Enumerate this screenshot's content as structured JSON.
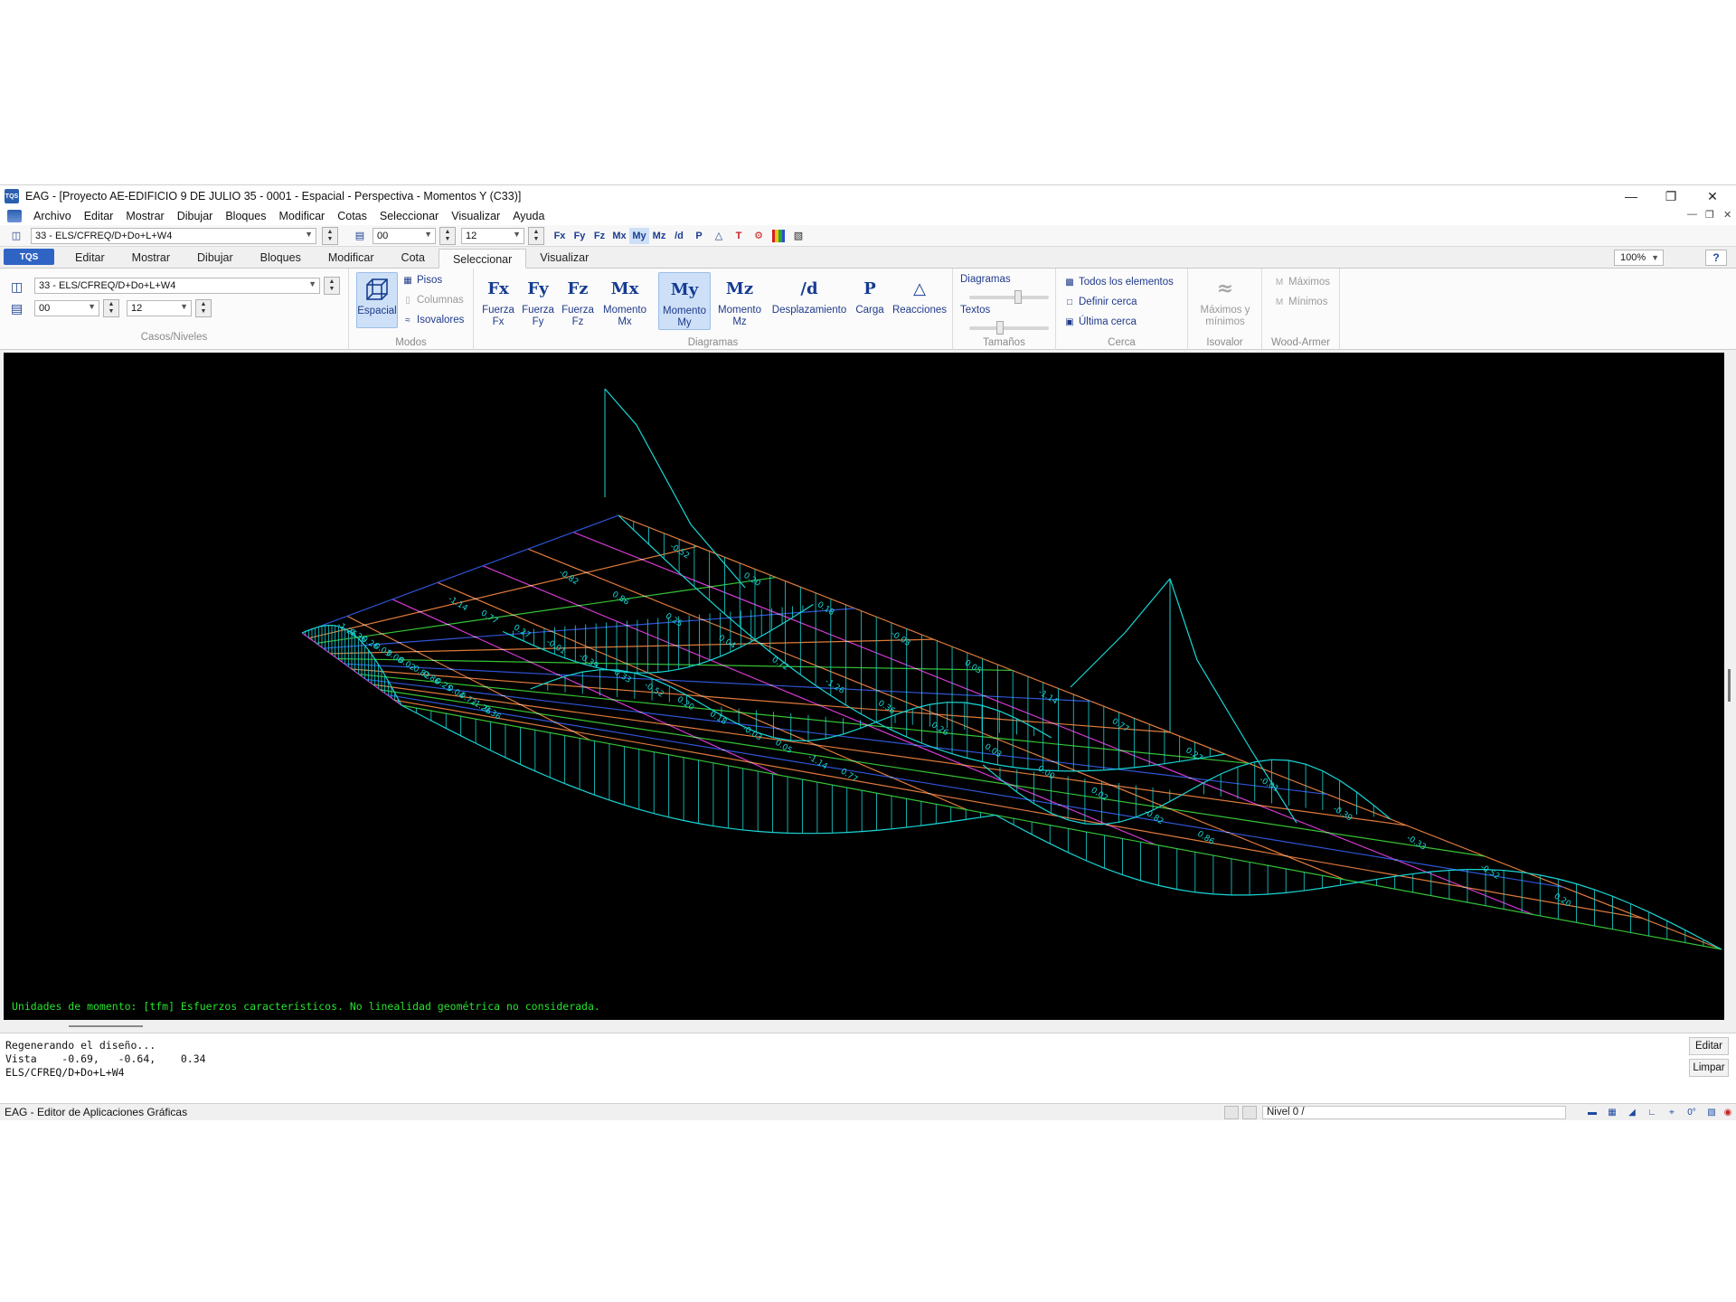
{
  "window": {
    "title": "EAG - [Proyecto AE-EDIFICIO 9 DE JULIO 35 - 0001 - Espacial - Perspectiva - Momentos Y (C33)]",
    "logo": "TQS"
  },
  "menu": [
    "Archivo",
    "Editar",
    "Mostrar",
    "Dibujar",
    "Bloques",
    "Modificar",
    "Cotas",
    "Seleccionar",
    "Visualizar",
    "Ayuda"
  ],
  "quickbar": {
    "case_value": "33 - ELS/CFREQ/D+Do+L+W4",
    "level_from": "00",
    "level_to": "12",
    "icons": [
      "Fx",
      "Fy",
      "Fz",
      "Mx",
      "My",
      "Mz",
      "/d",
      "P"
    ]
  },
  "tabs": {
    "app_button": "TQS",
    "items": [
      "Editar",
      "Mostrar",
      "Dibujar",
      "Bloques",
      "Modificar",
      "Cota",
      "Seleccionar",
      "Visualizar"
    ],
    "active": "Seleccionar",
    "zoom": "100%",
    "help": "?"
  },
  "ribbon": {
    "casos": {
      "case_value": "33 - ELS/CFREQ/D+Do+L+W4",
      "level_from": "00",
      "level_to": "12",
      "label": "Casos/Niveles"
    },
    "modos": {
      "label": "Modos",
      "espacial": "Espacial",
      "pisos": "Pisos",
      "columnas": "Columnas",
      "isovalores": "Isovalores"
    },
    "diagramas": {
      "label": "Diagramas",
      "buttons": [
        {
          "icon": "Fx",
          "label1": "Fuerza",
          "label2": "Fx"
        },
        {
          "icon": "Fy",
          "label1": "Fuerza",
          "label2": "Fy"
        },
        {
          "icon": "Fz",
          "label1": "Fuerza",
          "label2": "Fz"
        },
        {
          "icon": "Mx",
          "label1": "Momento",
          "label2": "Mx"
        },
        {
          "icon": "My",
          "label1": "Momento",
          "label2": "My"
        },
        {
          "icon": "Mz",
          "label1": "Momento",
          "label2": "Mz"
        },
        {
          "icon": "/d",
          "label1": "Desplazamiento",
          "label2": ""
        },
        {
          "icon": "P",
          "label1": "Carga",
          "label2": ""
        },
        {
          "icon": "△",
          "label1": "Reacciones",
          "label2": ""
        }
      ],
      "selected": "My"
    },
    "tamanos": {
      "label": "Tamaños",
      "diagramas": "Diagramas",
      "textos": "Textos",
      "diagramas_level": 0.62,
      "textos_level": 0.38
    },
    "cerca": {
      "label": "Cerca",
      "todos": "Todos los elementos",
      "definir": "Definir cerca",
      "ultima": "Última cerca"
    },
    "isovalor": {
      "label": "Isovalor",
      "btn1": "Máximos y",
      "btn2": "mínimos"
    },
    "wood": {
      "label": "Wood-Armer",
      "maximos": "Máximos",
      "minimos": "Mínimos"
    }
  },
  "canvas": {
    "note": "Unidades de momento: [tfm] Esfuerzos característicos. No linealidad geométrica no considerada.",
    "colors": {
      "diagram": "#19d6d6",
      "beam_orange": "#e07a3a",
      "beam_blue": "#2f55d6",
      "beam_magenta": "#d43ad4",
      "beam_green": "#35c235",
      "grid_white": "#d8d8d8"
    },
    "labels": [
      "-1.26",
      "-1.14",
      "-0.82",
      "-0.52",
      "0.36",
      "0.77",
      "0.86",
      "0.20",
      "0.26",
      "0.27",
      "0.25",
      "0.18",
      "0.03",
      "-0.01",
      "0.04",
      "-0.03",
      "0.00",
      "-0.39",
      "0.72",
      "0.05",
      "0.02",
      "-0.33"
    ]
  },
  "console": {
    "lines": [
      "Regenerando el diseño...",
      "Vista    -0.69,   -0.64,    0.34",
      "ELS/CFREQ/D+Do+L+W4"
    ],
    "edit": "Editar",
    "clear": "Limpar"
  },
  "status": {
    "left": "EAG - Editor de Aplicaciones Gráficas",
    "level": "Nivel 0 /"
  }
}
